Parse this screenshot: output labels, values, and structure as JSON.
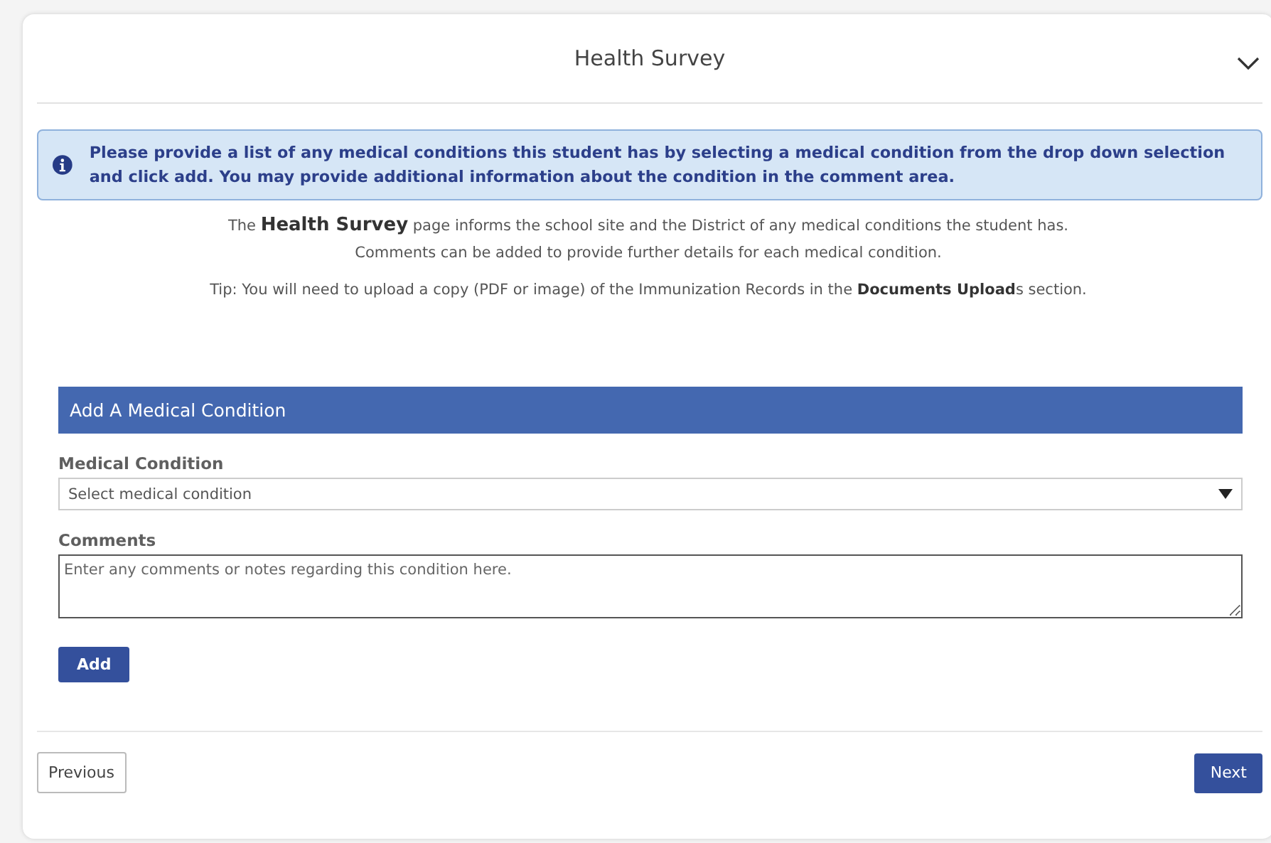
{
  "header": {
    "title": "Health Survey",
    "expanded": true
  },
  "info": "Please provide a list of any medical conditions this student has by selecting a medical condition from the drop down selection and click add. You may provide additional information about the condition in the comment area.",
  "description": [
    "The **Health Survey** page informs the school site and the District of any medical conditions the student has.",
    "Comments can be added to provide further details for each medical condition.",
    "Tip: You will need to upload a copy (PDF or image) of the Immunization Records in the **Documents Upload**s section."
  ],
  "panel": {
    "title": "Add A Medical Condition",
    "fields": [
      {
        "kind": "select",
        "label": "Medical Condition",
        "placeholder": "Select medical condition"
      },
      {
        "kind": "textarea",
        "label": "Comments",
        "placeholder": "Enter any comments or notes regarding this condition here."
      }
    ],
    "button": "Add"
  },
  "footer": {
    "previous": "Previous",
    "next": "Next"
  }
}
